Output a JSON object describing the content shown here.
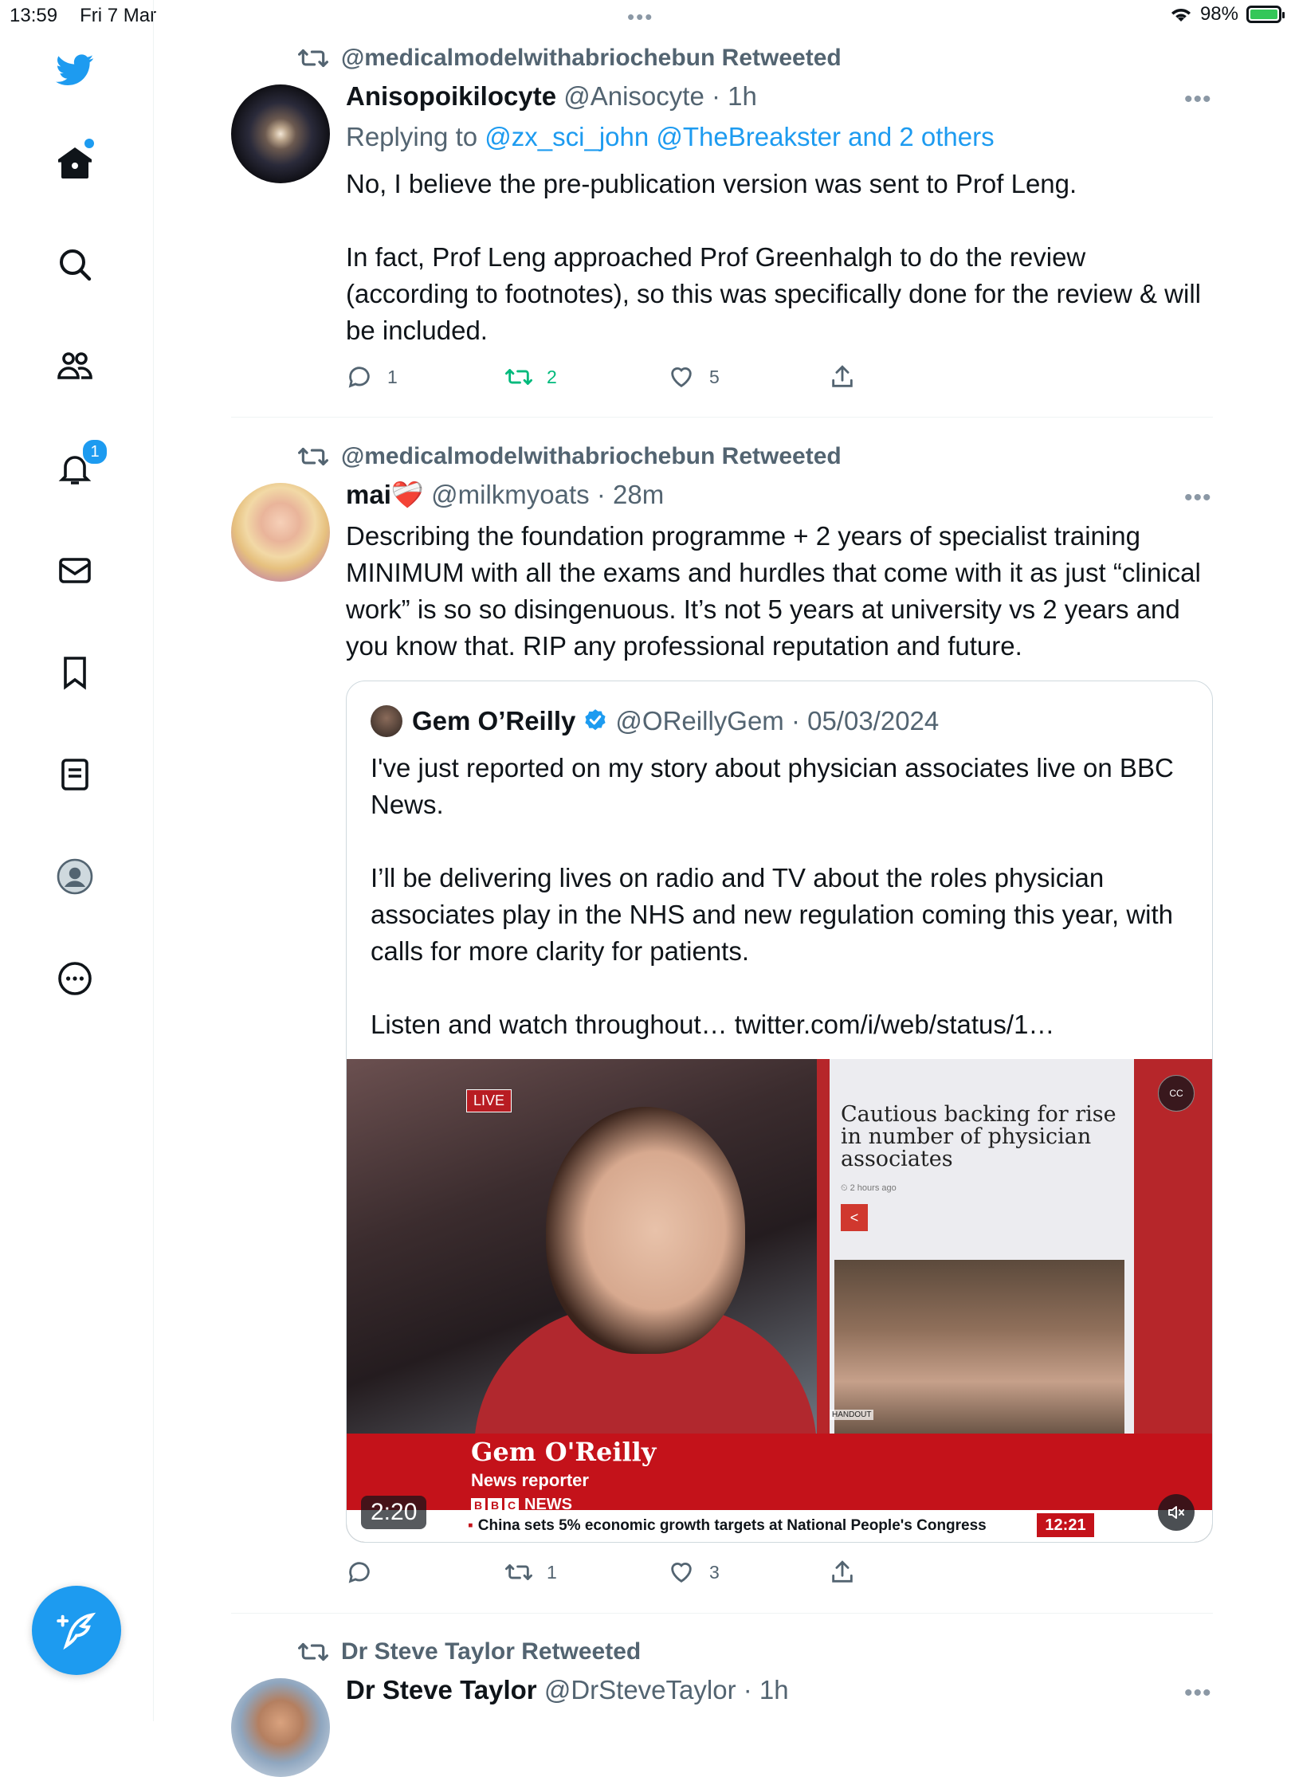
{
  "status_bar": {
    "time": "13:59",
    "date": "Fri 7 Mar",
    "dots": "•••",
    "battery": "98%"
  },
  "sidebar": {
    "items": [
      {
        "icon": "twitter-bird-icon"
      },
      {
        "icon": "home-icon",
        "has_dot": true
      },
      {
        "icon": "search-icon"
      },
      {
        "icon": "communities-icon"
      },
      {
        "icon": "notifications-icon",
        "badge": "1"
      },
      {
        "icon": "messages-icon"
      },
      {
        "icon": "bookmarks-icon"
      },
      {
        "icon": "lists-icon"
      },
      {
        "icon": "profile-icon"
      },
      {
        "icon": "more-icon"
      }
    ],
    "compose_icon": "compose-tweet-icon"
  },
  "tweets": [
    {
      "retweeted_by": "@medicalmodelwithabriochebun Retweeted",
      "name": "Anisopoikilocyte",
      "handle_time": "@Anisocyte · 1h",
      "replying_prefix": "Replying to",
      "replying_to": "@zx_sci_john @TheBreakster and 2 others",
      "text_p1": "No, I believe the pre-publication version was sent to Prof Leng.",
      "text_p2": "In fact, Prof Leng approached Prof Greenhalgh to do the review (according to footnotes), so this was specifically done for the review & will be included.",
      "replies": "1",
      "retweets": "2",
      "likes": "5",
      "more": "•••"
    },
    {
      "retweeted_by": "@medicalmodelwithabriochebun Retweeted",
      "name": "mai",
      "emoji": "❤️‍🩹",
      "handle_time": "@milkmyoats · 28m",
      "text": "Describing the foundation programme + 2 years of specialist training MINIMUM with all the exams and hurdles that come with it as just “clinical work” is so so disingenuous. It’s not 5 years at university vs 2 years and you know that. RIP any professional reputation and future.",
      "replies": "",
      "retweets": "1",
      "likes": "3",
      "more": "•••",
      "quote": {
        "name": "Gem O’Reilly",
        "handle_time": "@OReillyGem · 05/03/2024",
        "text_p1": "I've just reported on my story about physician associates live on BBC News.",
        "text_p2": "I’ll be delivering lives on radio and TV about the roles physician associates play in the NHS and new regulation coming this year, with calls for more clarity for patients.",
        "text_p3": "Listen and watch throughout… twitter.com/i/web/status/1…",
        "video": {
          "live_label": "LIVE",
          "panel_title": "Cautious backing for rise in number of physician associates",
          "panel_time": "⏲ 2 hours ago",
          "panel_caption": "HANDOUT",
          "lower_third_name": "Gem O'Reilly",
          "lower_third_role": "News reporter",
          "channel_letters": [
            "B",
            "B",
            "C"
          ],
          "channel_name": "NEWS",
          "ticker": "China sets 5% economic growth targets at National People's Congress",
          "clock": "12:21",
          "duration": "2:20",
          "cc_label": "CC"
        }
      }
    },
    {
      "retweeted_by": "Dr Steve Taylor Retweeted",
      "name": "Dr Steve Taylor",
      "handle_time": "@DrSteveTaylor · 1h",
      "more": "•••"
    }
  ],
  "colors": {
    "accent": "#1d9bf0",
    "retweet_green": "#00ba7c",
    "muted_text": "#536471",
    "bbc_red": "#c4121a"
  }
}
